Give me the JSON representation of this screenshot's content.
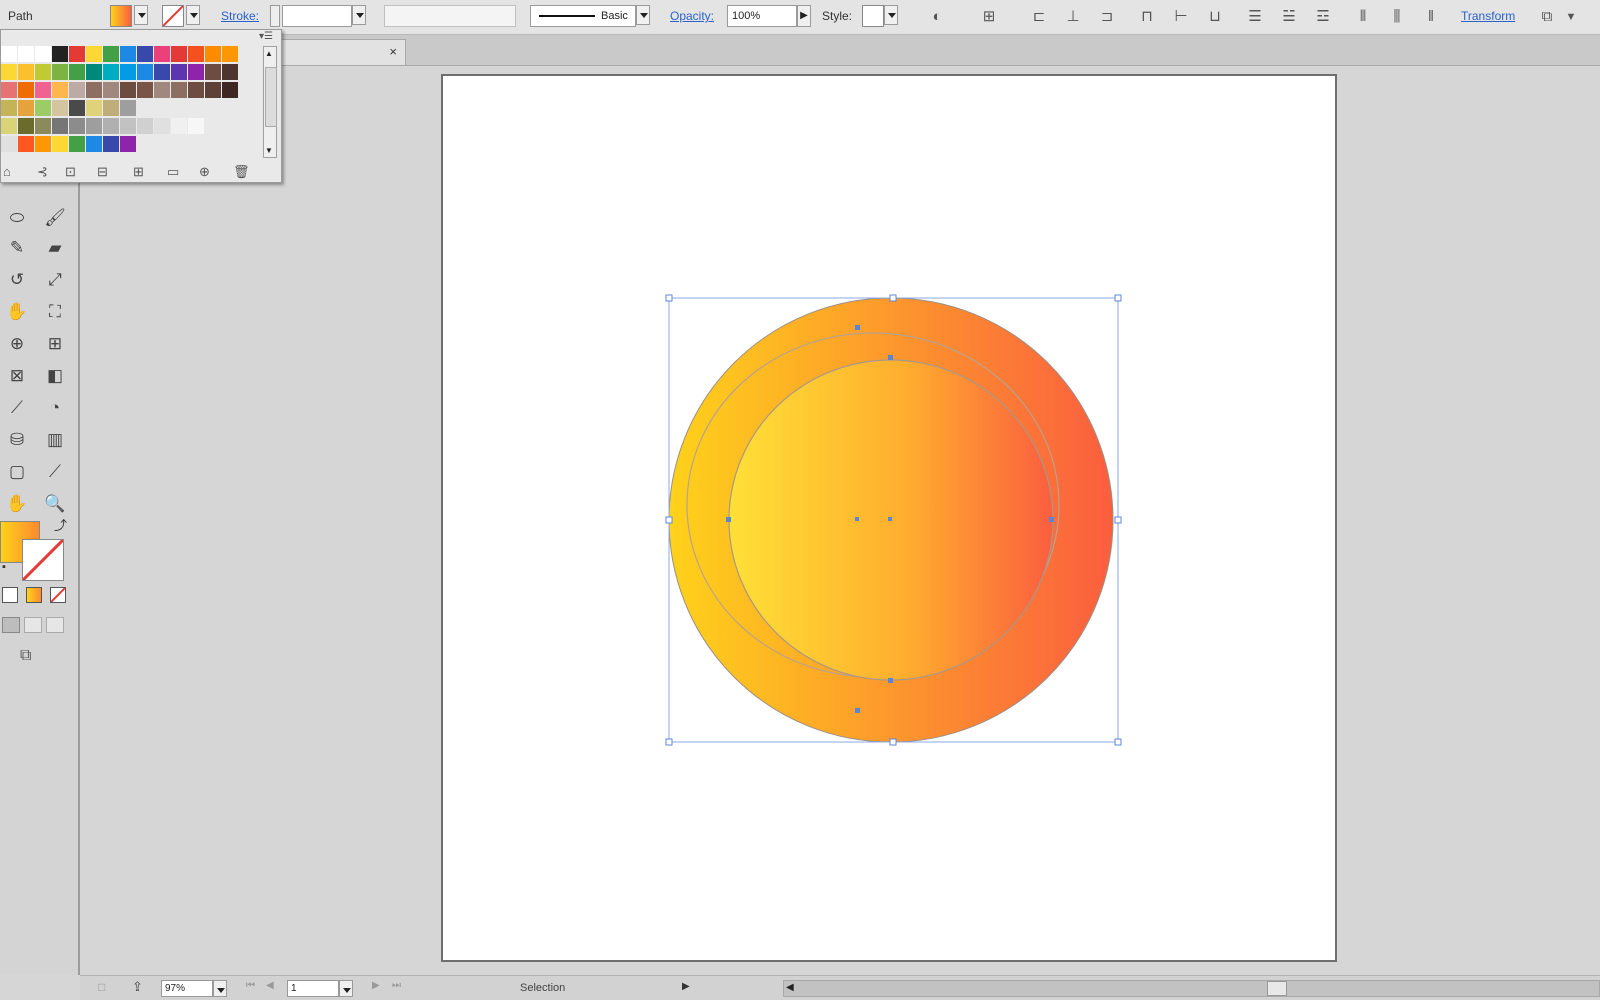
{
  "control_bar": {
    "object_type": "Path",
    "stroke_label": "Stroke:",
    "stroke_value": "",
    "brush_profile": "Basic",
    "opacity_label": "Opacity:",
    "opacity_value": "100%",
    "style_label": "Style:",
    "transform_label": "Transform"
  },
  "document_tab": {
    "close_glyph": "×"
  },
  "status_bar": {
    "zoom_value": "97%",
    "artboard_number": "1",
    "current_tool": "Selection"
  },
  "colors": {
    "fill_gradient_start": "#ffd21a",
    "fill_gradient_end": "#fb5e3f",
    "selection_blue": "#5b86d8"
  },
  "swatches": {
    "rows": [
      [
        "#ffffff",
        "#ffffff",
        "#ffffff",
        "#222222",
        "#e53935",
        "#fdd835",
        "#43a047",
        "#1e88e5",
        "#3949ab",
        "#ec407a",
        "#e53935",
        "#f4511e",
        "#fb8c00",
        "#ff9800"
      ],
      [
        "#fdd835",
        "#fbc02d",
        "#c0ca33",
        "#7cb342",
        "#43a047",
        "#00897b",
        "#00acc1",
        "#039be5",
        "#1e88e5",
        "#3949ab",
        "#5e35b1",
        "#8e24aa",
        "#6d4c41",
        "#4e342e"
      ],
      [
        "#e57373",
        "#ef6c00",
        "#f06292",
        "#ffb74d",
        "#bcaaa4",
        "#8d6e63",
        "#a1887f",
        "#6d4c41",
        "#795548",
        "#a1887f",
        "#8d6e63",
        "#6d4c41",
        "#5d4037",
        "#3e2723"
      ],
      [
        "#c5b358",
        "#e6a23c",
        "#9ccc65",
        "#d4c5a0",
        "#4a4a4a",
        "#e0d27a",
        "#bfae7a",
        "#9e9e9e"
      ],
      [
        "#d9d37a",
        "#6b6b2e",
        "#8a8a5c",
        "#767676",
        "#8c8c8c",
        "#9e9e9e",
        "#b0b0b0",
        "#c2c2c2",
        "#d0d0d0",
        "#e0e0e0",
        "#f0f0f0",
        "#f7f7f7"
      ],
      [
        "#e0e0e0",
        "#ff5722",
        "#ff9800",
        "#fdd835",
        "#43a047",
        "#1e88e5",
        "#3949ab",
        "#8e24aa"
      ]
    ]
  },
  "icons": {
    "tools": [
      "ellipse-tool-icon",
      "paintbrush-tool-icon",
      "pencil-tool-icon",
      "eraser-tool-icon",
      "rotate-tool-icon",
      "scale-tool-icon",
      "warp-tool-icon",
      "free-transform-tool-icon",
      "shape-builder-tool-icon",
      "perspective-grid-tool-icon",
      "mesh-tool-icon",
      "gradient-tool-icon",
      "eyedropper-tool-icon",
      "blend-tool-icon",
      "symbol-sprayer-tool-icon",
      "column-graph-tool-icon",
      "artboard-tool-icon",
      "slice-tool-icon",
      "hand-tool-icon",
      "zoom-tool-icon"
    ]
  }
}
